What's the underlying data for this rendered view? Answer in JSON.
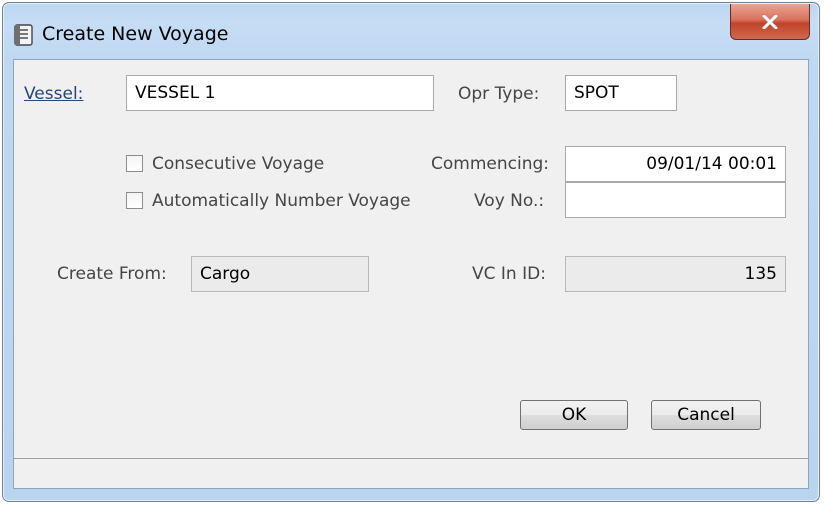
{
  "window": {
    "title": "Create New Voyage",
    "icon": "dialog-icon",
    "close_icon": "close-icon"
  },
  "form": {
    "vessel": {
      "label": "Vessel:",
      "value": "VESSEL 1"
    },
    "opr_type": {
      "label": "Opr Type:",
      "value": "SPOT"
    },
    "consecutive_voyage": {
      "label": "Consecutive Voyage",
      "checked": false
    },
    "auto_number_voyage": {
      "label": "Automatically Number Voyage",
      "checked": false
    },
    "commencing": {
      "label": "Commencing:",
      "value": "09/01/14 00:01"
    },
    "voy_no": {
      "label": "Voy No.:",
      "value": ""
    },
    "create_from": {
      "label": "Create From:",
      "value": "Cargo"
    },
    "vc_in_id": {
      "label": "VC In ID:",
      "value": "135"
    }
  },
  "buttons": {
    "ok": "OK",
    "cancel": "Cancel"
  },
  "colors": {
    "frame": "#bcd7f2",
    "close_button": "#c7462f",
    "link": "#24447a"
  }
}
